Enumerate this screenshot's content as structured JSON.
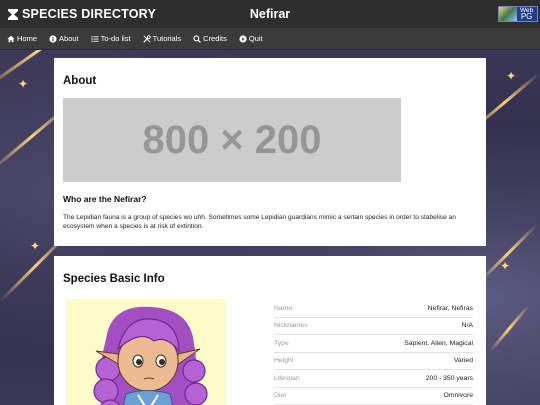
{
  "header": {
    "brand": "SPECIES DIRECTORY",
    "page_name": "Nefirar",
    "badge_line1": "Web",
    "badge_line2": "PG"
  },
  "nav": {
    "items": [
      {
        "label": "Home",
        "icon": "home-icon"
      },
      {
        "label": "About",
        "icon": "info-icon"
      },
      {
        "label": "To-do list",
        "icon": "list-icon"
      },
      {
        "label": "Tutorials",
        "icon": "tools-icon"
      },
      {
        "label": "Credits",
        "icon": "search-icon"
      },
      {
        "label": "Quit",
        "icon": "power-icon"
      }
    ]
  },
  "about": {
    "title": "About",
    "image_placeholder": "800 × 200",
    "subheading": "Who are the Nefirar?",
    "description": "The Lepidian fauna is a group of species wo uhh. Sometimes some Lepidian guardians mimic a sertain species in order to stabelise an ecosystem when a species is at risk of extintion."
  },
  "basic_info": {
    "title": "Species Basic Info",
    "rows": [
      {
        "label": "Name",
        "value": "Nefirar, Nefiras"
      },
      {
        "label": "Nicknames",
        "value": "N/A"
      },
      {
        "label": "Type",
        "value": "Sapient, Alien, Magical"
      },
      {
        "label": "Height",
        "value": "Varied"
      },
      {
        "label": "Lifespan",
        "value": "200 - 350 years"
      },
      {
        "label": "Diet",
        "value": "Omnivore"
      }
    ]
  },
  "colors": {
    "topbar": "#2e2e2e",
    "navbar": "#3b3b3b",
    "card": "#ffffff",
    "placeholder": "#cccccc"
  }
}
